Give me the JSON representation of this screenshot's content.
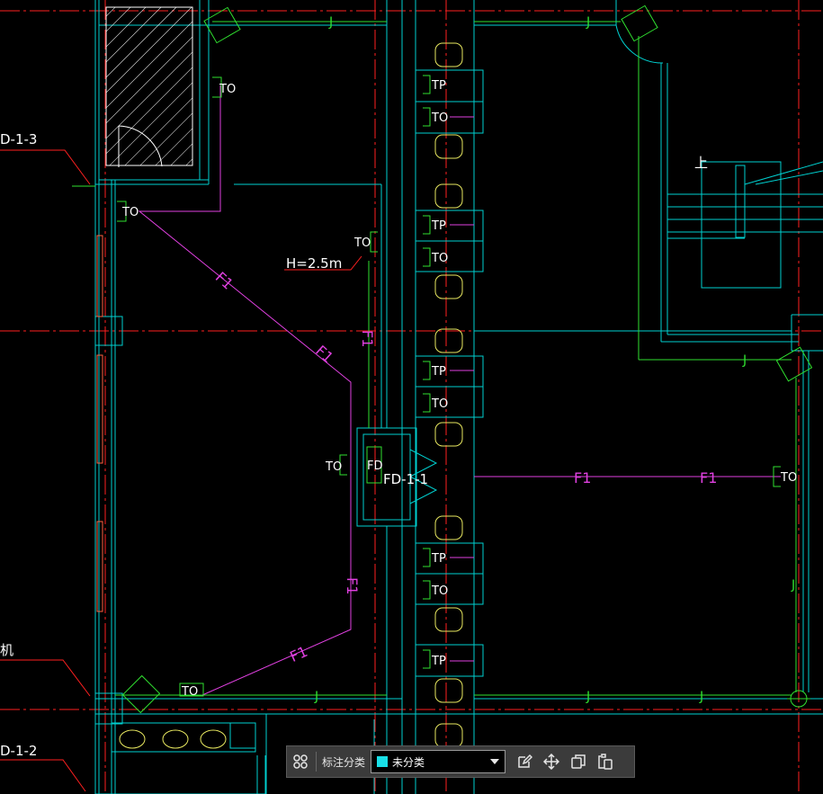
{
  "drawing": {
    "labels": {
      "to": "TO",
      "tp": "TP",
      "fd": "FD",
      "fd_cabinet": "FD-1-1",
      "height_note": "H=2.5m",
      "route": "F1",
      "j": "J",
      "up": "上",
      "cut_left_top": "D-1-3",
      "cut_left_bottom": "D-1-2",
      "cut_machine": "机"
    },
    "colors": {
      "background": "#000000",
      "wall": "#00d0d0",
      "axis": "#ff2020",
      "cable": "#e040e0",
      "device": "#30e030",
      "furniture": "#e8e860",
      "text": "#ffffff"
    }
  },
  "toolbar": {
    "category_label": "标注分类",
    "selected_value": "未分类",
    "swatch_color": "#19e0e8",
    "icons": [
      "grid-icon",
      "edit-icon",
      "move-icon",
      "copy-icon",
      "paste-icon"
    ]
  }
}
